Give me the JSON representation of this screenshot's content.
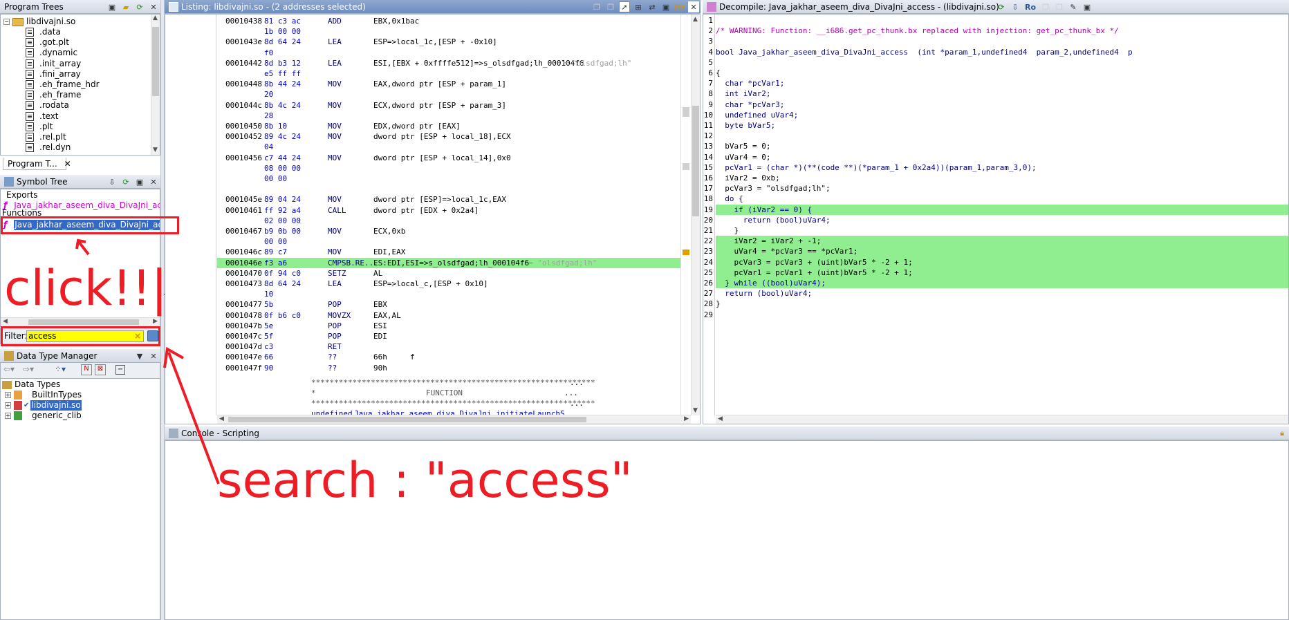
{
  "program_trees": {
    "title": "Program Trees",
    "root": "libdivajni.so",
    "items": [
      ".data",
      ".got.plt",
      ".dynamic",
      ".init_array",
      ".fini_array",
      ".eh_frame_hdr",
      ".eh_frame",
      ".rodata",
      ".text",
      ".plt",
      ".rel.plt",
      ".rel.dyn"
    ],
    "tab_label": "Program T..."
  },
  "symbol_tree": {
    "title": "Symbol Tree",
    "exports_label": "Exports",
    "export_item": "Java_jakhar_aseem_diva_DivaJni_access",
    "functions_label": "Functions",
    "function_item": "Java_jakhar_aseem_diva_DivaJni_access",
    "filter_label": "Filter:",
    "filter_value": "access"
  },
  "data_type_manager": {
    "title": "Data Type Manager",
    "root": "Data Types",
    "items": [
      "BuiltInTypes",
      "libdivajni.so",
      "generic_clib"
    ]
  },
  "listing": {
    "title": "Listing:  libdivajni.so - (2 addresses selected)",
    "rows": [
      {
        "addr": "00010438",
        "bytes": "81 c3 ac",
        "mnem": "ADD",
        "ops": "EBX,0x1bac"
      },
      {
        "addr": "",
        "bytes": "1b 00 00",
        "mnem": "",
        "ops": ""
      },
      {
        "addr": "0001043e",
        "bytes": "8d 64 24",
        "mnem": "LEA",
        "ops": "ESP=>local_1c,[ESP + -0x10]"
      },
      {
        "addr": "",
        "bytes": "f0",
        "mnem": "",
        "ops": ""
      },
      {
        "addr": "00010442",
        "bytes": "8d b3 12",
        "mnem": "LEA",
        "ops": "ESI,[EBX + 0xffffe512]=>s_olsdfgad;lh_000104f6",
        "cmt": "= \"olsdfgad;lh\""
      },
      {
        "addr": "",
        "bytes": "e5 ff ff",
        "mnem": "",
        "ops": ""
      },
      {
        "addr": "00010448",
        "bytes": "8b 44 24",
        "mnem": "MOV",
        "ops": "EAX,dword ptr [ESP + param_1]"
      },
      {
        "addr": "",
        "bytes": "20",
        "mnem": "",
        "ops": ""
      },
      {
        "addr": "0001044c",
        "bytes": "8b 4c 24",
        "mnem": "MOV",
        "ops": "ECX,dword ptr [ESP + param_3]"
      },
      {
        "addr": "",
        "bytes": "28",
        "mnem": "",
        "ops": ""
      },
      {
        "addr": "00010450",
        "bytes": "8b 10",
        "mnem": "MOV",
        "ops": "EDX,dword ptr [EAX]"
      },
      {
        "addr": "00010452",
        "bytes": "89 4c 24",
        "mnem": "MOV",
        "ops": "dword ptr [ESP + local_18],ECX"
      },
      {
        "addr": "",
        "bytes": "04",
        "mnem": "",
        "ops": ""
      },
      {
        "addr": "00010456",
        "bytes": "c7 44 24",
        "mnem": "MOV",
        "ops": "dword ptr [ESP + local_14],0x0"
      },
      {
        "addr": "",
        "bytes": "08 00 00",
        "mnem": "",
        "ops": ""
      },
      {
        "addr": "",
        "bytes": "00 00",
        "mnem": "",
        "ops": ""
      },
      {
        "addr": "",
        "bytes": "",
        "mnem": "",
        "ops": ""
      },
      {
        "addr": "0001045e",
        "bytes": "89 04 24",
        "mnem": "MOV",
        "ops": "dword ptr [ESP]=>local_1c,EAX"
      },
      {
        "addr": "00010461",
        "bytes": "ff 92 a4",
        "mnem": "CALL",
        "ops": "dword ptr [EDX + 0x2a4]"
      },
      {
        "addr": "",
        "bytes": "02 00 00",
        "mnem": "",
        "ops": ""
      },
      {
        "addr": "00010467",
        "bytes": "b9 0b 00",
        "mnem": "MOV",
        "ops": "ECX,0xb"
      },
      {
        "addr": "",
        "bytes": "00 00",
        "mnem": "",
        "ops": ""
      },
      {
        "addr": "0001046c",
        "bytes": "89 c7",
        "mnem": "MOV",
        "ops": "EDI,EAX"
      },
      {
        "addr": "0001046e",
        "bytes": "f3 a6",
        "mnem": "CMPSB.RE...",
        "ops": "ES:EDI,ESI=>s_olsdfgad;lh_000104f6",
        "cmt": "= \"olsdfgad;lh\""
      },
      {
        "addr": "00010470",
        "bytes": "0f 94 c0",
        "mnem": "SETZ",
        "ops": "AL"
      },
      {
        "addr": "00010473",
        "bytes": "8d 64 24",
        "mnem": "LEA",
        "ops": "ESP=>local_c,[ESP + 0x10]"
      },
      {
        "addr": "",
        "bytes": "10",
        "mnem": "",
        "ops": ""
      },
      {
        "addr": "00010477",
        "bytes": "5b",
        "mnem": "POP",
        "ops": "EBX"
      },
      {
        "addr": "00010478",
        "bytes": "0f b6 c0",
        "mnem": "MOVZX",
        "ops": "EAX,AL"
      },
      {
        "addr": "0001047b",
        "bytes": "5e",
        "mnem": "POP",
        "ops": "ESI"
      },
      {
        "addr": "0001047c",
        "bytes": "5f",
        "mnem": "POP",
        "ops": "EDI"
      },
      {
        "addr": "0001047d",
        "bytes": "c3",
        "mnem": "RET",
        "ops": ""
      },
      {
        "addr": "0001047e",
        "bytes": "66",
        "mnem": "??",
        "ops": "66h     f"
      },
      {
        "addr": "0001047f",
        "bytes": "90",
        "mnem": "??",
        "ops": "90h"
      }
    ],
    "stars": "**************************************************************",
    "function_banner": "FUNCTION",
    "next_func_type": "undefined",
    "next_func_name": "Java_jakhar_aseem_diva_DivaJni_initiateLaunchS",
    "ellipsis": "..."
  },
  "decompile": {
    "title": "Decompile: Java_jakhar_aseem_diva_DivaJni_access -  (libdivajni.so)",
    "ro_label": "Ro",
    "lines": [
      "",
      "/* WARNING: Function: __i686.get_pc_thunk.bx replaced with injection: get_pc_thunk_bx */",
      "",
      "bool Java_jakhar_aseem_diva_DivaJni_access  (int *param_1,undefined4  param_2,undefined4  p",
      "",
      "{",
      "  char *pcVar1;",
      "  int iVar2;",
      "  char *pcVar3;",
      "  undefined uVar4;",
      "  byte bVar5;",
      "",
      "  bVar5 = 0;",
      "  uVar4 = 0;",
      "  pcVar1 = (char *)(**(code **)(*param_1 + 0x2a4))(param_1,param_3,0);",
      "  iVar2 = 0xb;",
      "  pcVar3 = \"olsdfgad;lh\";",
      "  do {",
      "    if (iVar2 == 0) {",
      "      return (bool)uVar4;",
      "    }",
      "    iVar2 = iVar2 + -1;",
      "    uVar4 = *pcVar3 == *pcVar1;",
      "    pcVar3 = pcVar3 + (uint)bVar5 * -2 + 1;",
      "    pcVar1 = pcVar1 + (uint)bVar5 * -2 + 1;",
      "  } while ((bool)uVar4);",
      "  return (bool)uVar4;",
      "}",
      ""
    ]
  },
  "console": {
    "title": "Console - Scripting"
  },
  "annotations": {
    "click": "click!!|",
    "search": "search : \"access\""
  },
  "colors": {
    "highlight": "#90ee90",
    "annotation_red": "#ee1c24",
    "selection_blue": "#3268c8"
  }
}
